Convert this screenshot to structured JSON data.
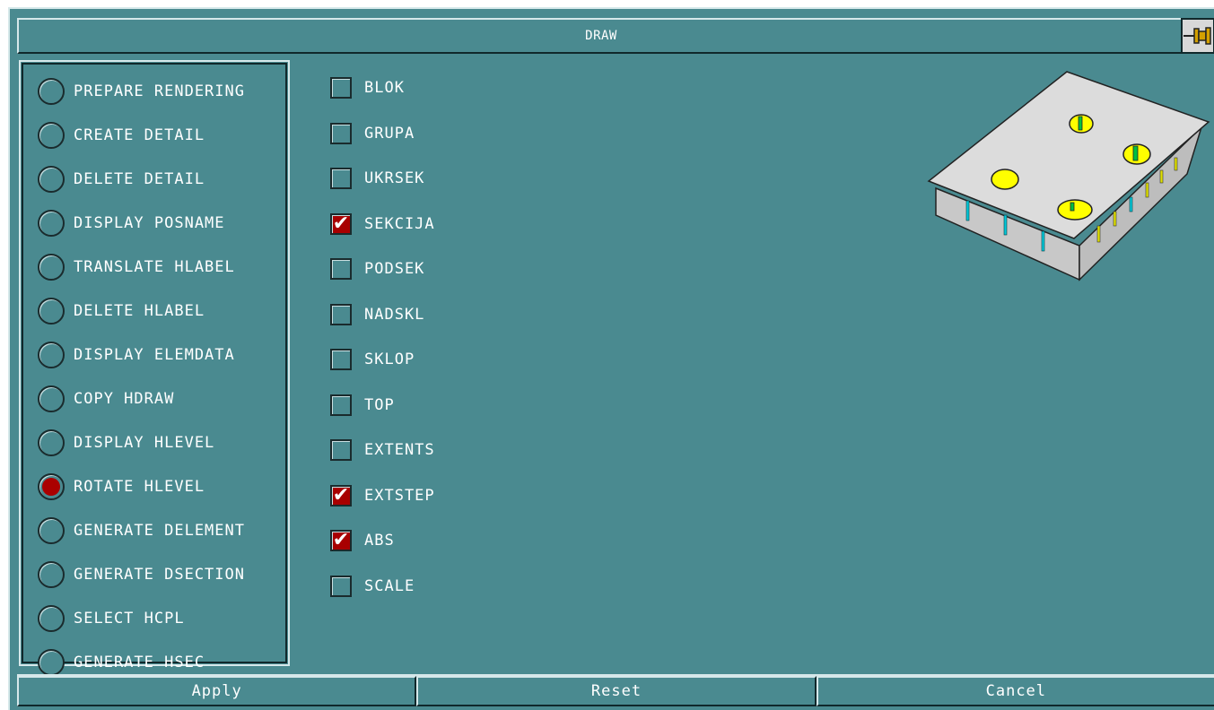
{
  "window": {
    "title": "DRAW"
  },
  "radio_options": [
    {
      "label": "PREPARE RENDERING",
      "selected": false
    },
    {
      "label": "CREATE DETAIL",
      "selected": false
    },
    {
      "label": "DELETE DETAIL",
      "selected": false
    },
    {
      "label": "DISPLAY POSNAME",
      "selected": false
    },
    {
      "label": "TRANSLATE HLABEL",
      "selected": false
    },
    {
      "label": "DELETE HLABEL",
      "selected": false
    },
    {
      "label": "DISPLAY ELEMDATA",
      "selected": false
    },
    {
      "label": "COPY HDRAW",
      "selected": false
    },
    {
      "label": "DISPLAY HLEVEL",
      "selected": false
    },
    {
      "label": "ROTATE HLEVEL",
      "selected": true
    },
    {
      "label": "GENERATE DELEMENT",
      "selected": false
    },
    {
      "label": "GENERATE DSECTION",
      "selected": false
    },
    {
      "label": "SELECT HCPL",
      "selected": false
    },
    {
      "label": "GENERATE HSEC",
      "selected": false
    }
  ],
  "check_options": [
    {
      "label": "BLOK",
      "checked": false
    },
    {
      "label": "GRUPA",
      "checked": false
    },
    {
      "label": "UKRSEK",
      "checked": false
    },
    {
      "label": "SEKCIJA",
      "checked": true
    },
    {
      "label": "PODSEK",
      "checked": false
    },
    {
      "label": "NADSKL",
      "checked": false
    },
    {
      "label": "SKLOP",
      "checked": false
    },
    {
      "label": "TOP",
      "checked": false
    },
    {
      "label": "EXTENTS",
      "checked": false
    },
    {
      "label": "EXTSTEP",
      "checked": true
    },
    {
      "label": "ABS",
      "checked": true
    },
    {
      "label": "SCALE",
      "checked": false
    }
  ],
  "buttons": {
    "apply": "Apply",
    "reset": "Reset",
    "cancel": "Cancel"
  },
  "colors": {
    "panel": "#4a8a90",
    "selected": "#aa0000",
    "plate": "#d9d9d9",
    "holes": "#ffff00"
  }
}
